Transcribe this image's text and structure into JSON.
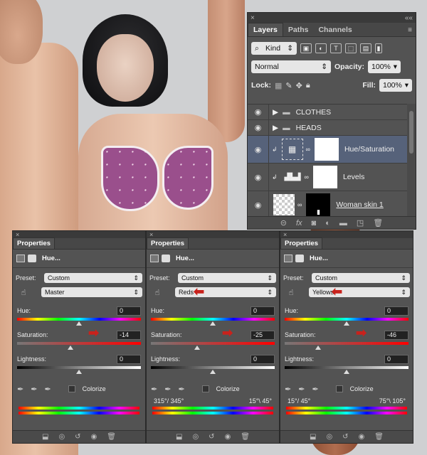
{
  "layers_panel": {
    "close": "×",
    "collapse": "««",
    "tabs": [
      "Layers",
      "Paths",
      "Channels"
    ],
    "menu": "≡",
    "filter_label": "Kind",
    "blend_mode": "Normal",
    "opacity_label": "Opacity:",
    "opacity_value": "100%",
    "lock_label": "Lock:",
    "fill_label": "Fill:",
    "fill_value": "100%",
    "layers": [
      {
        "name": "CLOTHES",
        "type": "group"
      },
      {
        "name": "HEADS",
        "type": "group"
      },
      {
        "name": "Hue/Saturation",
        "type": "adjustment",
        "selected": true
      },
      {
        "name": "Levels",
        "type": "adjustment"
      },
      {
        "name": "Woman skin 1",
        "type": "pixel"
      }
    ]
  },
  "properties_panels": [
    {
      "tab": "Properties",
      "title": "Hue...",
      "preset_label": "Preset:",
      "preset": "Custom",
      "channel": "Master",
      "hue_label": "Hue:",
      "hue": "0",
      "hue_level": 0.5,
      "saturation_label": "Saturation:",
      "saturation": "-14",
      "saturation_level": 0.43,
      "lightness_label": "Lightness:",
      "lightness": "0",
      "lightness_level": 0.5,
      "colorize_label": "Colorize",
      "range_left": "",
      "range_right": ""
    },
    {
      "tab": "Properties",
      "title": "Hue...",
      "preset_label": "Preset:",
      "preset": "Custom",
      "channel": "Reds",
      "hue_label": "Hue:",
      "hue": "0",
      "hue_level": 0.5,
      "saturation_label": "Saturation:",
      "saturation": "-25",
      "saturation_level": 0.375,
      "lightness_label": "Lightness:",
      "lightness": "0",
      "lightness_level": 0.5,
      "colorize_label": "Colorize",
      "range_left": "315°/ 345°",
      "range_right": "15°\\ 45°"
    },
    {
      "tab": "Properties",
      "title": "Hue...",
      "preset_label": "Preset:",
      "preset": "Custom",
      "channel": "Yellows",
      "hue_label": "Hue:",
      "hue": "0",
      "hue_level": 0.5,
      "saturation_label": "Saturation:",
      "saturation": "-46",
      "saturation_level": 0.27,
      "lightness_label": "Lightness:",
      "lightness": "0",
      "lightness_level": 0.5,
      "colorize_label": "Colorize",
      "range_left": "15°/ 45°",
      "range_right": "75°\\ 105°"
    }
  ],
  "colors": {
    "panel_bg": "#535353",
    "selected_row": "#56627a",
    "arrow": "#c8221c"
  }
}
